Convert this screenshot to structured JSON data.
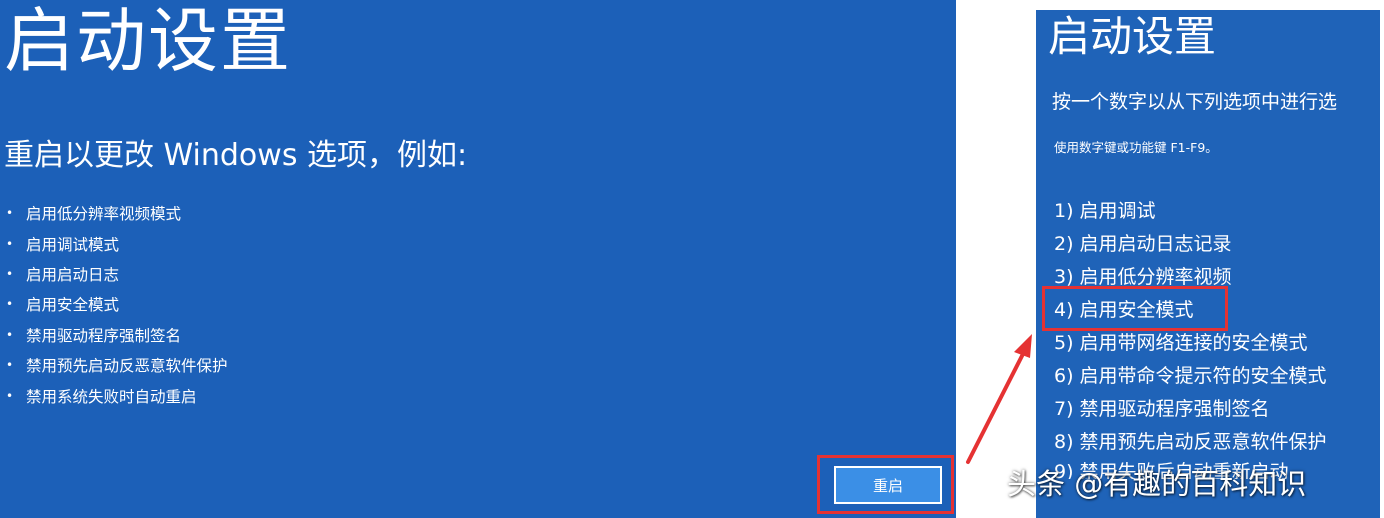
{
  "left_screen": {
    "title": "启动设置",
    "subtitle": "重启以更改 Windows 选项，例如:",
    "options": [
      "启用低分辨率视频模式",
      "启用调试模式",
      "启用启动日志",
      "启用安全模式",
      "禁用驱动程序强制签名",
      "禁用预先启动反恶意软件保护",
      "禁用系统失败时自动重启"
    ],
    "restart_button_label": "重启"
  },
  "right_screen": {
    "title": "启动设置",
    "instruction": "按一个数字以从下列选项中进行选",
    "hint": "使用数字键或功能键 F1-F9。",
    "options": [
      "1) 启用调试",
      "2) 启用启动日志记录",
      "3) 启用低分辨率视频",
      "4) 启用安全模式",
      "5) 启用带网络连接的安全模式",
      "6) 启用带命令提示符的安全模式",
      "7) 禁用驱动程序强制签名",
      "8) 禁用预先启动反恶意软件保护",
      "9) 禁用失败后自动重新启动"
    ],
    "highlighted_option_index": 3
  },
  "watermark": "头条 @有趣的百科知识",
  "colors": {
    "screen_blue": "#1c60b8",
    "highlight_red": "#e53233",
    "button_blue": "#3b8fe6"
  }
}
